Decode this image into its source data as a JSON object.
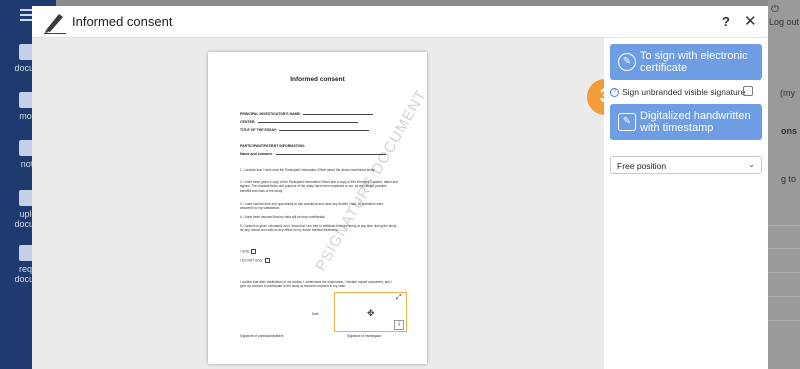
{
  "background": {
    "logout_label": "Log out",
    "sidebar": [
      {
        "label": "docum"
      },
      {
        "label": "mod"
      },
      {
        "label": "noti"
      },
      {
        "label": "uplo\ndocum"
      },
      {
        "label": "requ\ndocum"
      }
    ],
    "right_fragments": [
      "(my",
      "ons",
      "g to"
    ]
  },
  "modal": {
    "title": "Informed consent",
    "help_label": "?",
    "close_label": "✕",
    "step_badge": "3"
  },
  "document": {
    "title": "Informed consent",
    "fields": [
      "PRINCIPAL INVESTIGATOR'S NAME:",
      "CENTER:",
      "TITLE OF THE ESSAY:"
    ],
    "section": "PARTICIPANT/PATIENT INFORMATION:",
    "name_field": "Name and surname :",
    "paragraphs": [
      "1. I declare that I have read the Participant Information Sheet about the above-mentioned study.",
      "2. I have been given a copy of the Participant Information Sheet and a copy of this Informed Consent, dated and signed. The characteristics and purpose of the study have been explained to me, as well as the possible benefits and risks of the study.",
      "3. I have had the time and opportunity to ask questions and raise any doubts I had. All questions were answered to my satisfaction.",
      "4. I have been assured that my data will be kept confidential.",
      "5. Consent is given voluntarily and I know that I am free to withdraw from the study at any time during the study for any reason and without any effect on my future medical treatment."
    ],
    "give_label": "I GIVE",
    "not_give_label": "I DO NOT GIVE",
    "confirm": "I confirm that after clarification of my doubts, I understand the information, I declare myself competent, and I give my consent to participate in the study or research required in my case.",
    "date_label": "Date",
    "sig_participant": "Signature of participant/patient",
    "sig_investigator": "Signature of investigator",
    "watermark": "PSIGNATURE DOCUMENT"
  },
  "panel": {
    "electronic_btn": "To sign with electronic certificate",
    "unbranded_label": "Sign unbranded visible signature",
    "handwritten_btn": "Digitalized handwritten with timestamp",
    "position_select": "Free position"
  },
  "colors": {
    "accent": "#6e9de3",
    "badge": "#f49b3a",
    "sidebar": "#1e3a6e"
  }
}
